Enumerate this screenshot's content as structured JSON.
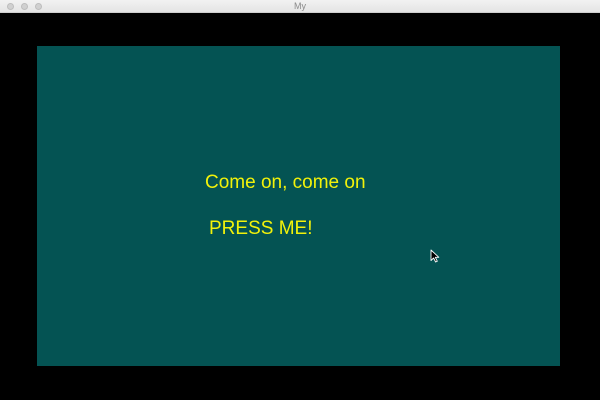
{
  "window": {
    "title": "My"
  },
  "main": {
    "message": "Come on, come on",
    "button_label": "PRESS ME!"
  },
  "colors": {
    "panel_background": "#045353",
    "text": "#f2f20a",
    "outer_background": "#000000"
  },
  "icons": {
    "cursor": "mouse-pointer-icon"
  }
}
